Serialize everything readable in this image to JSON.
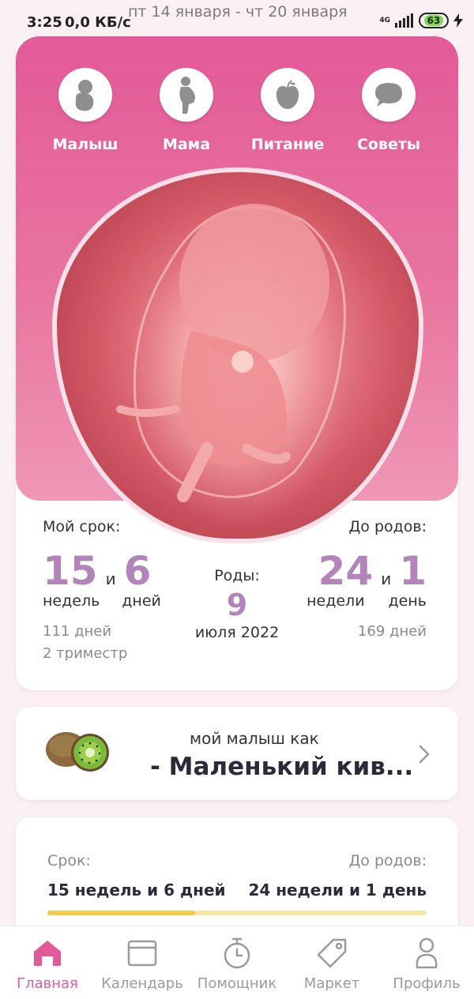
{
  "status_bar": {
    "time": "3:25",
    "speed": "0,0 КБ/с",
    "date_range": "пт 14 января - чт 20 января",
    "network": "4G",
    "battery": "63"
  },
  "categories": [
    {
      "label": "Малыш",
      "icon": "baby-icon"
    },
    {
      "label": "Мама",
      "icon": "pregnant-woman-icon"
    },
    {
      "label": "Питание",
      "icon": "apple-icon"
    },
    {
      "label": "Советы",
      "icon": "chat-bubble-icon"
    }
  ],
  "term": {
    "my_term_label": "Мой срок:",
    "weeks": "15",
    "and1": "и",
    "days": "6",
    "weeks_unit": "недель",
    "days_unit": "дней",
    "total_days": "111 дней",
    "trimester": "2 триместр"
  },
  "birth": {
    "label": "Роды:",
    "day": "9",
    "month_year": "июля 2022"
  },
  "until": {
    "label": "До родов:",
    "weeks": "24",
    "and1": "и",
    "days": "1",
    "weeks_unit": "недели",
    "days_unit": "день",
    "total_days": "169 дней"
  },
  "fruit": {
    "subtitle": "мой малыш как",
    "title": "- Маленький кив...",
    "image": "kiwi-icon"
  },
  "progress": {
    "term_label": "Срок:",
    "term_value": "15 недель и 6 дней",
    "until_label": "До родов:",
    "until_value": "24 недели и 1 день",
    "fraction": 0.39
  },
  "nav": [
    {
      "label": "Главная",
      "icon": "home-icon"
    },
    {
      "label": "Календарь",
      "icon": "calendar-icon"
    },
    {
      "label": "Помощник",
      "icon": "stopwatch-icon"
    },
    {
      "label": "Маркет",
      "icon": "tag-icon"
    },
    {
      "label": "Профиль",
      "icon": "profile-icon"
    }
  ],
  "colors": {
    "accent": "#e35a98",
    "number": "#b384b9",
    "progress": "#f0cd4a"
  }
}
